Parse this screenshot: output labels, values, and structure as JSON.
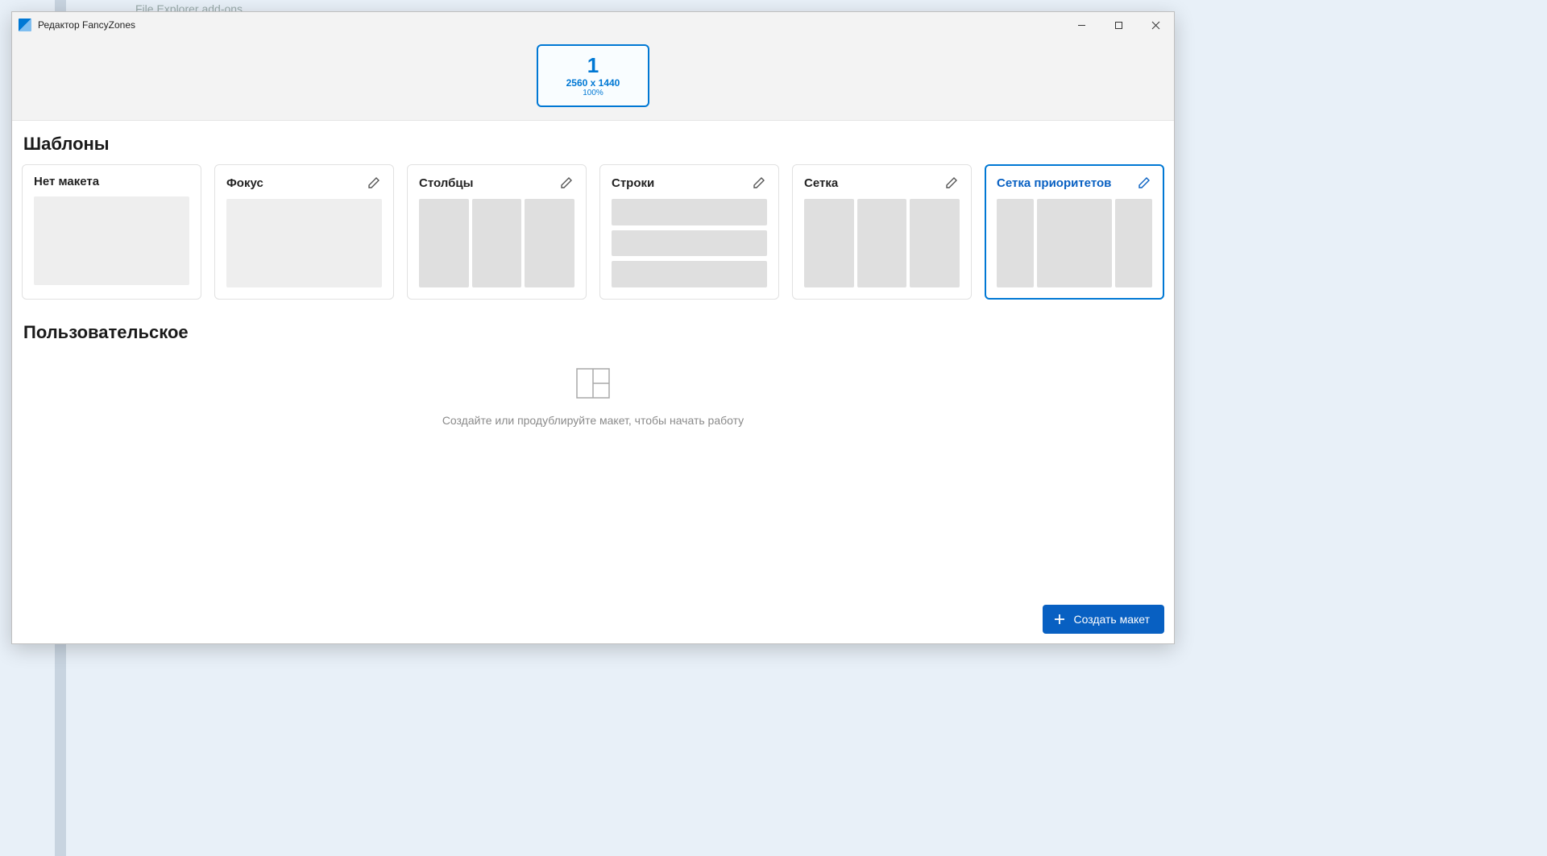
{
  "backdrop": {
    "hint_text": "File Explorer add-ons"
  },
  "window": {
    "title": "Редактор FancyZones",
    "controls": {
      "minimize": "—",
      "maximize": "▢",
      "close": "✕"
    }
  },
  "monitor": {
    "index": "1",
    "resolution": "2560 x 1440",
    "scale": "100%"
  },
  "sections": {
    "templates_title": "Шаблоны",
    "custom_title": "Пользовательское"
  },
  "templates": [
    {
      "id": "blank",
      "label": "Нет макета",
      "editable": false,
      "selected": false,
      "preview": "blank"
    },
    {
      "id": "focus",
      "label": "Фокус",
      "editable": true,
      "selected": false,
      "preview": "focus"
    },
    {
      "id": "columns",
      "label": "Столбцы",
      "editable": true,
      "selected": false,
      "preview": "cols"
    },
    {
      "id": "rows",
      "label": "Строки",
      "editable": true,
      "selected": false,
      "preview": "rows"
    },
    {
      "id": "grid",
      "label": "Сетка",
      "editable": true,
      "selected": false,
      "preview": "grid"
    },
    {
      "id": "priority",
      "label": "Сетка приоритетов",
      "editable": true,
      "selected": true,
      "preview": "priority"
    }
  ],
  "custom_empty_message": "Создайте или продублируйте макет, чтобы начать работу",
  "create_button_label": "Создать макет"
}
